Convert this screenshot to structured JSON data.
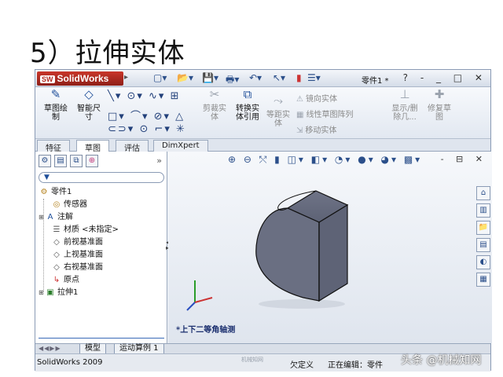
{
  "slide": {
    "title": "5）拉伸实体"
  },
  "app": {
    "name": "SolidWorks",
    "document_title": "零件1 *",
    "window_buttons": "? - _ □ ✕"
  },
  "ribbon": {
    "sketch": "草图绘\n制",
    "smart_dim": "智能尺\n寸",
    "trim": "剪裁实\n体",
    "convert": "转换实\n体引用",
    "offset": "等距实\n体",
    "mirror": "镜向实体",
    "linear_pattern": "线性草图阵列",
    "move": "移动实体",
    "display_delete": "显示/删\n除几...",
    "repair": "修复草\n图"
  },
  "tabs": [
    {
      "label": "特征"
    },
    {
      "label": "草图"
    },
    {
      "label": "评估"
    },
    {
      "label": "DimXpert"
    }
  ],
  "tree": {
    "root": "零件1",
    "items": [
      {
        "label": "传感器",
        "icon": "sensor-icon"
      },
      {
        "label": "注解",
        "icon": "annotation-icon"
      },
      {
        "label": "材质 <未指定>",
        "icon": "material-icon"
      },
      {
        "label": "前视基准面",
        "icon": "plane-icon"
      },
      {
        "label": "上视基准面",
        "icon": "plane-icon"
      },
      {
        "label": "右视基准面",
        "icon": "plane-icon"
      },
      {
        "label": "原点",
        "icon": "origin-icon"
      },
      {
        "label": "拉伸1",
        "icon": "extrude-icon"
      }
    ]
  },
  "viewport": {
    "view_label": "*上下二等角轴测"
  },
  "bottom_tabs": [
    {
      "label": "模型"
    },
    {
      "label": "运动算例 1"
    }
  ],
  "status": {
    "version": "SolidWorks 2009",
    "underdefined": "欠定义",
    "editing": "正在编辑：零件",
    "faint_mark": "机械知网"
  },
  "watermark": {
    "text": "头条 @机械知网"
  }
}
